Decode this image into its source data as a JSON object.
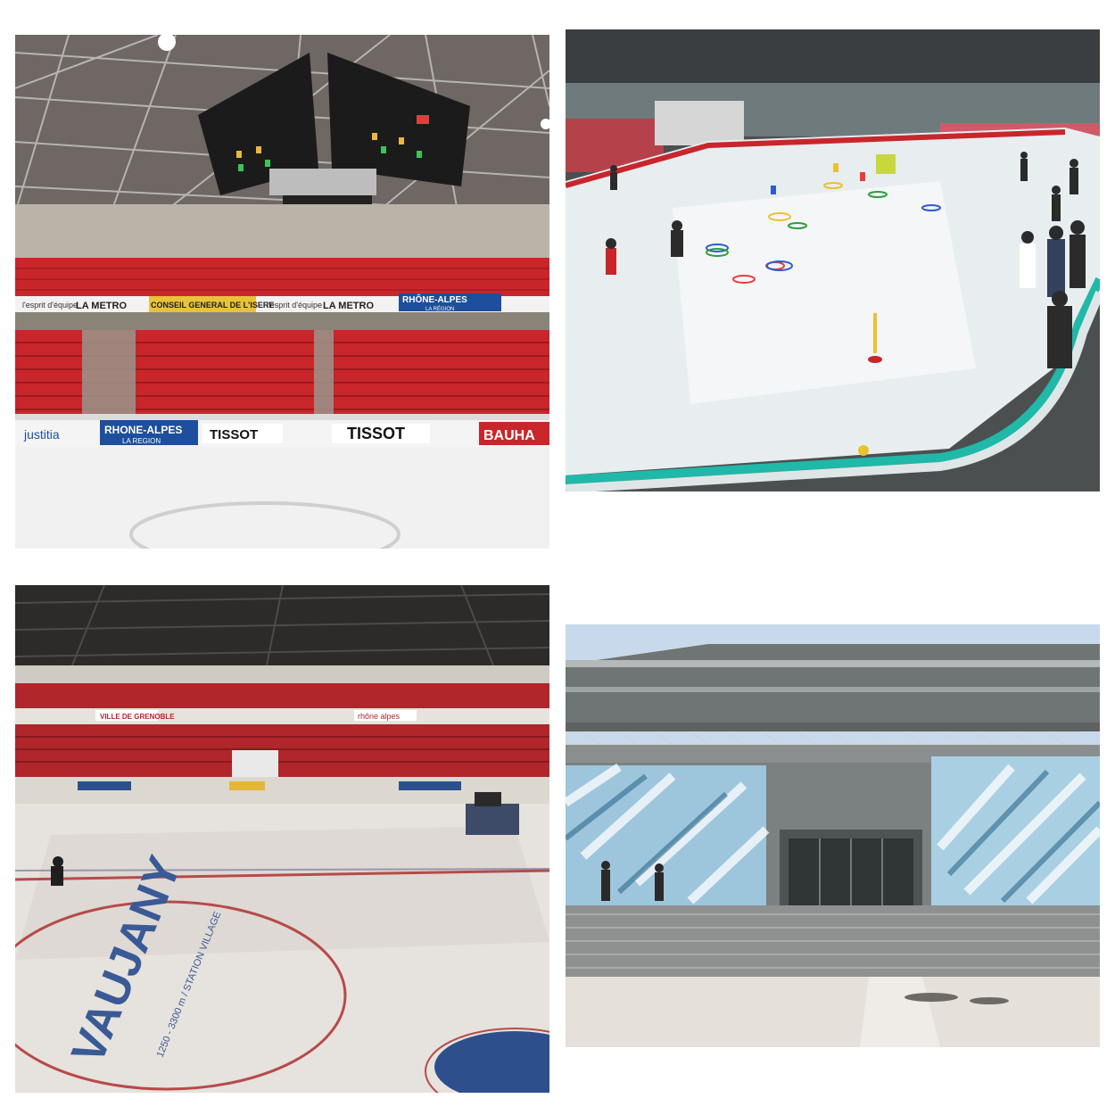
{
  "photos": [
    {
      "id": "arena-seats",
      "board_ads": [
        "justitia",
        "RHONE-ALPES",
        "LA REGION",
        "TISSOT",
        "TISSOT",
        "BAUHA"
      ],
      "upper_banners": [
        "l'esprit d'équipe",
        "LA METRO",
        "CONSEIL GENERAL DE L'ISERE",
        "l'esprit d'équipe",
        "LA METRO",
        "RHÔNE-ALPES",
        "LA RÉGION"
      ]
    },
    {
      "id": "practice-rink"
    },
    {
      "id": "arena-ice-resurfacing",
      "ice_logo": "VAUJANY",
      "ice_logo_sub": "1250 - 3300 m / STATION VILLAGE",
      "banners": [
        "VILLE DE GRENOBLE",
        "rhône alpes"
      ]
    },
    {
      "id": "building-exterior"
    }
  ],
  "colors": {
    "seat_red": "#c8262b",
    "ice": "#eef1f3",
    "rink_board_teal": "#20b8a8",
    "sky": "#c7d9ea"
  }
}
